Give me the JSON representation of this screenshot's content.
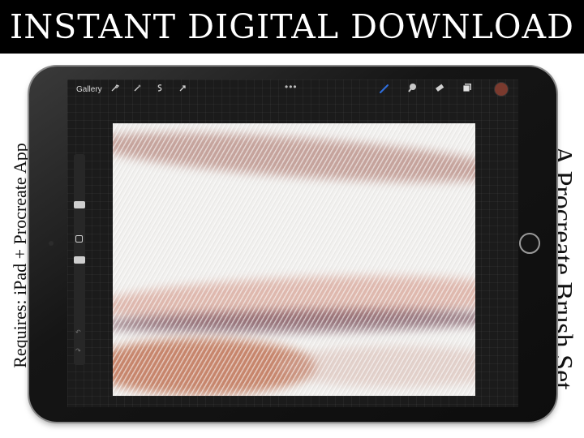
{
  "banner": {
    "title": "INSTANT DIGITAL DOWNLOAD"
  },
  "side_left": {
    "text": "Requires: iPad + Procreate App"
  },
  "side_right": {
    "text": "A Procreate Brush Set"
  },
  "app": {
    "toolbar": {
      "gallery_label": "Gallery",
      "left_icons": [
        "wrench-icon",
        "magic-wand-icon",
        "selection-icon",
        "transform-arrow-icon"
      ],
      "more_dots": "•••",
      "right_icons": [
        "brush-icon",
        "smudge-icon",
        "eraser-icon",
        "layers-icon"
      ],
      "active_color": "#7a3a2e"
    },
    "sidebar": {
      "undo": "↶",
      "redo": "↷"
    }
  },
  "colors": {
    "brush_accent": "#2f6fe0",
    "stroke_rose": "#b88a80",
    "stroke_plum": "#6e4452",
    "stroke_rust": "#b9623f",
    "stroke_blush": "#d9a193"
  }
}
